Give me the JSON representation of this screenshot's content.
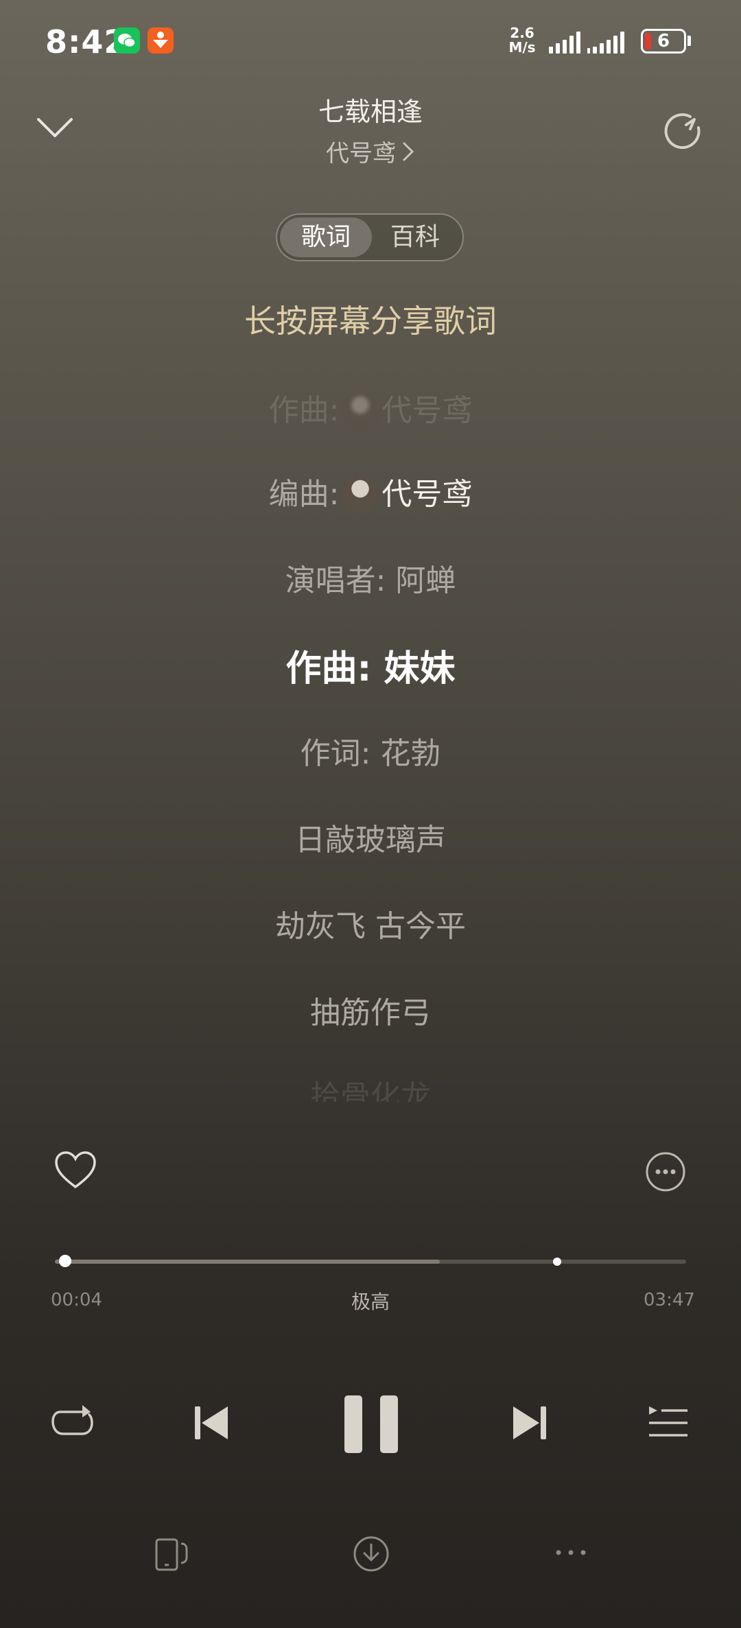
{
  "status_bar": {
    "time": "8:42",
    "net_speed_value": "2.6",
    "net_speed_unit": "M/s",
    "battery": "6",
    "battery_level": 0.06,
    "app_icons": [
      "wechat-icon",
      "orange-app-icon"
    ]
  },
  "header": {
    "collapse_icon": "chevron-down-icon",
    "title": "七载相逢",
    "artist": "代号鸢",
    "artist_chevron": "chevron-right-icon",
    "share_icon": "share-icon"
  },
  "tabs": [
    {
      "label": "歌词",
      "active": true
    },
    {
      "label": "百科",
      "active": false
    }
  ],
  "lyrics": {
    "hint": "长按屏幕分享歌词",
    "lines": [
      {
        "label": "作曲:",
        "name": "代号鸢"
      },
      {
        "label": "编曲:",
        "name": "代号鸢"
      },
      {
        "text": "演唱者: 阿蝉"
      },
      {
        "text": "作曲: 妹妹"
      },
      {
        "text": "作词: 花勃"
      },
      {
        "text": "日敲玻璃声"
      },
      {
        "text": "劫灰飞 古今平"
      },
      {
        "text": "抽筋作弓"
      },
      {
        "text": "拾骨化龙"
      }
    ]
  },
  "player": {
    "like_icon": "heart-icon",
    "more_icon": "more-circle-icon",
    "elapsed": "00:04",
    "duration": "03:47",
    "quality": "极高",
    "progress_fraction": 0.018,
    "buffer_fraction": 0.61
  },
  "controls": [
    "repeat-icon",
    "previous-icon",
    "pause-icon",
    "next-icon",
    "playlist-icon"
  ],
  "bottom_bar": [
    "device-icon",
    "download-icon",
    "more-dots-icon"
  ],
  "colors": {
    "hint": "#dfcfa8",
    "current_line": "#ffffff",
    "battery_low": "#e23a2f"
  }
}
